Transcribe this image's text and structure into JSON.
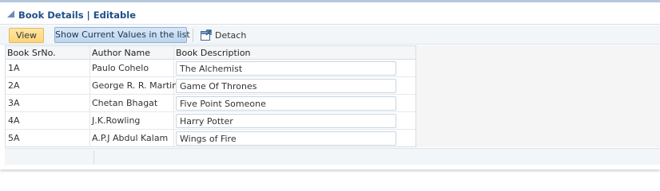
{
  "panel": {
    "title": "Book Details | Editable"
  },
  "toolbar": {
    "view_label": "View",
    "show_values_label": "Show Current Values in the list",
    "detach_label": "Detach"
  },
  "table": {
    "columns": [
      "Book SrNo.",
      "Author Name",
      "Book Description"
    ],
    "rows": [
      {
        "srno": "1A",
        "author": "Paulo Cohelo",
        "description": "The Alchemist"
      },
      {
        "srno": "2A",
        "author": "George R. R. Martin",
        "description": "Game Of Thrones"
      },
      {
        "srno": "3A",
        "author": "Chetan Bhagat",
        "description": "Five Point Someone"
      },
      {
        "srno": "4A",
        "author": "J.K.Rowling",
        "description": "Harry Potter"
      },
      {
        "srno": "5A",
        "author": "A.P.J Abdul Kalam",
        "description": "Wings of Fire"
      }
    ]
  },
  "colors": {
    "title": "#1f4f8a",
    "view_button": "#fdd57a",
    "show_button": "#bcd5ee"
  }
}
